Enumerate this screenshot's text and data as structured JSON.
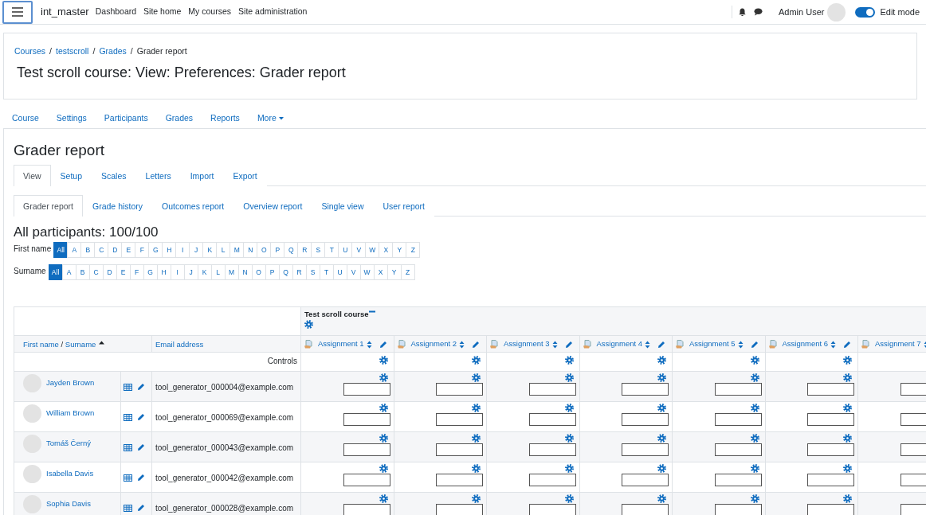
{
  "navbar": {
    "brand": "int_master",
    "links": [
      "Dashboard",
      "Site home",
      "My courses",
      "Site administration"
    ],
    "user": "Admin User",
    "edit_mode": {
      "label": "Edit mode",
      "on": true
    }
  },
  "breadcrumb": [
    {
      "label": "Courses",
      "kind": "link"
    },
    {
      "label": "/",
      "kind": "separator"
    },
    {
      "label": "testscroll",
      "kind": "link"
    },
    {
      "label": "/",
      "kind": "separator"
    },
    {
      "label": "Grades",
      "kind": "link"
    },
    {
      "label": "/",
      "kind": "separator"
    },
    {
      "label": "Grader report",
      "kind": "current"
    }
  ],
  "page_title": "Test scroll course: View: Preferences: Grader report",
  "secondary_nav": [
    {
      "label": "Course",
      "kind": "link"
    },
    {
      "label": "Settings",
      "kind": "link"
    },
    {
      "label": "Participants",
      "kind": "link"
    },
    {
      "label": "Grades",
      "kind": "link"
    },
    {
      "label": "Reports",
      "kind": "link"
    },
    {
      "label": "More",
      "kind": "menu"
    }
  ],
  "report_title": "Grader report",
  "tabs": [
    {
      "label": "View",
      "selected": true
    },
    {
      "label": "Setup",
      "selected": false
    },
    {
      "label": "Scales",
      "selected": false
    },
    {
      "label": "Letters",
      "selected": false
    },
    {
      "label": "Import",
      "selected": false
    },
    {
      "label": "Export",
      "selected": false
    }
  ],
  "subtabs": [
    {
      "label": "Grader report",
      "selected": true
    },
    {
      "label": "Grade history",
      "selected": false
    },
    {
      "label": "Outcomes report",
      "selected": false
    },
    {
      "label": "Overview report",
      "selected": false
    },
    {
      "label": "Single view",
      "selected": false
    },
    {
      "label": "User report",
      "selected": false
    }
  ],
  "participants_heading": "All participants: 100/100",
  "initials": [
    {
      "label": "First name",
      "letters": [
        {
          "label": "All",
          "selected": true
        },
        {
          "label": "A",
          "selected": false
        },
        {
          "label": "B",
          "selected": false
        },
        {
          "label": "C",
          "selected": false
        },
        {
          "label": "D",
          "selected": false
        },
        {
          "label": "E",
          "selected": false
        },
        {
          "label": "F",
          "selected": false
        },
        {
          "label": "G",
          "selected": false
        },
        {
          "label": "H",
          "selected": false
        },
        {
          "label": "I",
          "selected": false
        },
        {
          "label": "J",
          "selected": false
        },
        {
          "label": "K",
          "selected": false
        },
        {
          "label": "L",
          "selected": false
        },
        {
          "label": "M",
          "selected": false
        },
        {
          "label": "N",
          "selected": false
        },
        {
          "label": "O",
          "selected": false
        },
        {
          "label": "P",
          "selected": false
        },
        {
          "label": "Q",
          "selected": false
        },
        {
          "label": "R",
          "selected": false
        },
        {
          "label": "S",
          "selected": false
        },
        {
          "label": "T",
          "selected": false
        },
        {
          "label": "U",
          "selected": false
        },
        {
          "label": "V",
          "selected": false
        },
        {
          "label": "W",
          "selected": false
        },
        {
          "label": "X",
          "selected": false
        },
        {
          "label": "Y",
          "selected": false
        },
        {
          "label": "Z",
          "selected": false
        }
      ]
    },
    {
      "label": "Surname",
      "letters": [
        {
          "label": "All",
          "selected": true
        },
        {
          "label": "A",
          "selected": false
        },
        {
          "label": "B",
          "selected": false
        },
        {
          "label": "C",
          "selected": false
        },
        {
          "label": "D",
          "selected": false
        },
        {
          "label": "E",
          "selected": false
        },
        {
          "label": "F",
          "selected": false
        },
        {
          "label": "G",
          "selected": false
        },
        {
          "label": "H",
          "selected": false
        },
        {
          "label": "I",
          "selected": false
        },
        {
          "label": "J",
          "selected": false
        },
        {
          "label": "K",
          "selected": false
        },
        {
          "label": "L",
          "selected": false
        },
        {
          "label": "M",
          "selected": false
        },
        {
          "label": "N",
          "selected": false
        },
        {
          "label": "O",
          "selected": false
        },
        {
          "label": "P",
          "selected": false
        },
        {
          "label": "Q",
          "selected": false
        },
        {
          "label": "R",
          "selected": false
        },
        {
          "label": "S",
          "selected": false
        },
        {
          "label": "T",
          "selected": false
        },
        {
          "label": "U",
          "selected": false
        },
        {
          "label": "V",
          "selected": false
        },
        {
          "label": "W",
          "selected": false
        },
        {
          "label": "X",
          "selected": false
        },
        {
          "label": "Y",
          "selected": false
        },
        {
          "label": "Z",
          "selected": false
        }
      ]
    }
  ],
  "table": {
    "category": "Test scroll course",
    "name_header": {
      "first": "First name",
      "separator": "/",
      "second": "Surname"
    },
    "email_header": "Email address",
    "assignments": [
      "Assignment 1",
      "Assignment 2",
      "Assignment 3",
      "Assignment 4",
      "Assignment 5",
      "Assignment 6",
      "Assignment 7"
    ],
    "controls_label": "Controls",
    "rows": [
      {
        "name": "Jayden Brown",
        "email": "tool_generator_000004@example.com"
      },
      {
        "name": "William Brown",
        "email": "tool_generator_000069@example.com"
      },
      {
        "name": "Tomáš Černý",
        "email": "tool_generator_000043@example.com"
      },
      {
        "name": "Isabella Davis",
        "email": "tool_generator_000042@example.com"
      },
      {
        "name": "Sophia Davis",
        "email": "tool_generator_000028@example.com"
      }
    ]
  }
}
